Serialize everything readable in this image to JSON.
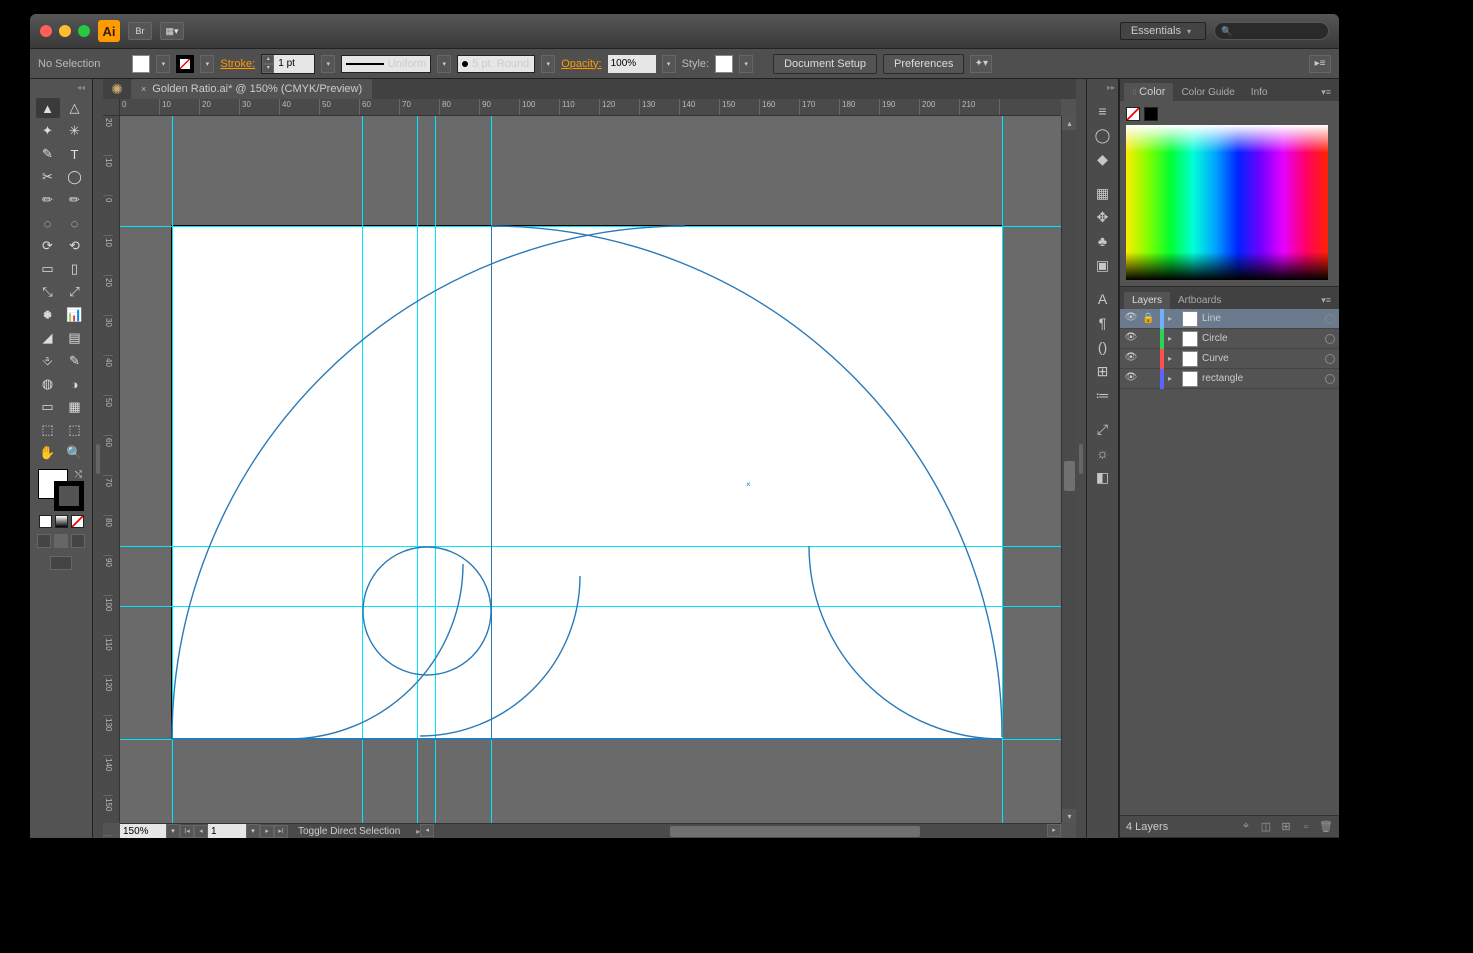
{
  "app": {
    "logo": "Ai",
    "bridge": "Br"
  },
  "workspace": {
    "label": "Essentials"
  },
  "search": {
    "placeholder": ""
  },
  "controlbar": {
    "selection_status": "No Selection",
    "stroke_label": "Stroke:",
    "stroke_weight": "1 pt",
    "stroke_profile": "Uniform",
    "brush": "5 pt. Round",
    "opacity_label": "Opacity:",
    "opacity_value": "100%",
    "style_label": "Style:",
    "doc_setup": "Document Setup",
    "preferences": "Preferences"
  },
  "document": {
    "tab_title": "Golden Ratio.ai* @ 150% (CMYK/Preview)",
    "zoom": "150%",
    "artboard_index": "1",
    "status_hint": "Toggle Direct Selection",
    "ruler_h": [
      "0",
      "10",
      "20",
      "30",
      "40",
      "50",
      "60",
      "70",
      "80",
      "90",
      "100",
      "110",
      "120",
      "130",
      "140",
      "150",
      "160",
      "170",
      "180",
      "190",
      "200",
      "210"
    ],
    "ruler_v": [
      "20",
      "10",
      "0",
      "10",
      "20",
      "30",
      "40",
      "50",
      "60",
      "70",
      "80",
      "90",
      "100",
      "110",
      "120",
      "130",
      "140",
      "150"
    ]
  },
  "panels": {
    "color": {
      "tabs": [
        "Color",
        "Color Guide",
        "Info"
      ]
    },
    "layers": {
      "tabs": [
        "Layers",
        "Artboards"
      ],
      "items": [
        {
          "name": "Line",
          "color": "#6fb3ff",
          "locked": true,
          "selected": true
        },
        {
          "name": "Circle",
          "color": "#2ad455",
          "locked": false,
          "selected": false
        },
        {
          "name": "Curve",
          "color": "#ff4f4f",
          "locked": false,
          "selected": false
        },
        {
          "name": "rectangle",
          "color": "#5b63ff",
          "locked": false,
          "selected": false
        }
      ],
      "count_label": "4 Layers"
    }
  },
  "dock": {
    "icons": [
      "≡",
      "◯",
      "◆",
      "▦",
      "✥",
      "♣",
      "▣",
      "A",
      "¶",
      "()",
      "⊞",
      "≔",
      "⤢",
      "☼",
      "◧"
    ]
  },
  "tools": {
    "left": [
      "▲",
      "✦",
      "✎",
      "✂",
      "✏",
      "◌",
      "⟳",
      "▭",
      "⤡",
      "🞺",
      "◢",
      "⎀",
      "◍",
      "▭",
      "⬚",
      "✋"
    ],
    "right": [
      "△",
      "✳",
      "T",
      "◯",
      "✏",
      "◌",
      "⟲",
      "▯",
      "⤢",
      "📊",
      "▤",
      "✎",
      "◑",
      "▦",
      "⬚",
      "🔍"
    ]
  }
}
